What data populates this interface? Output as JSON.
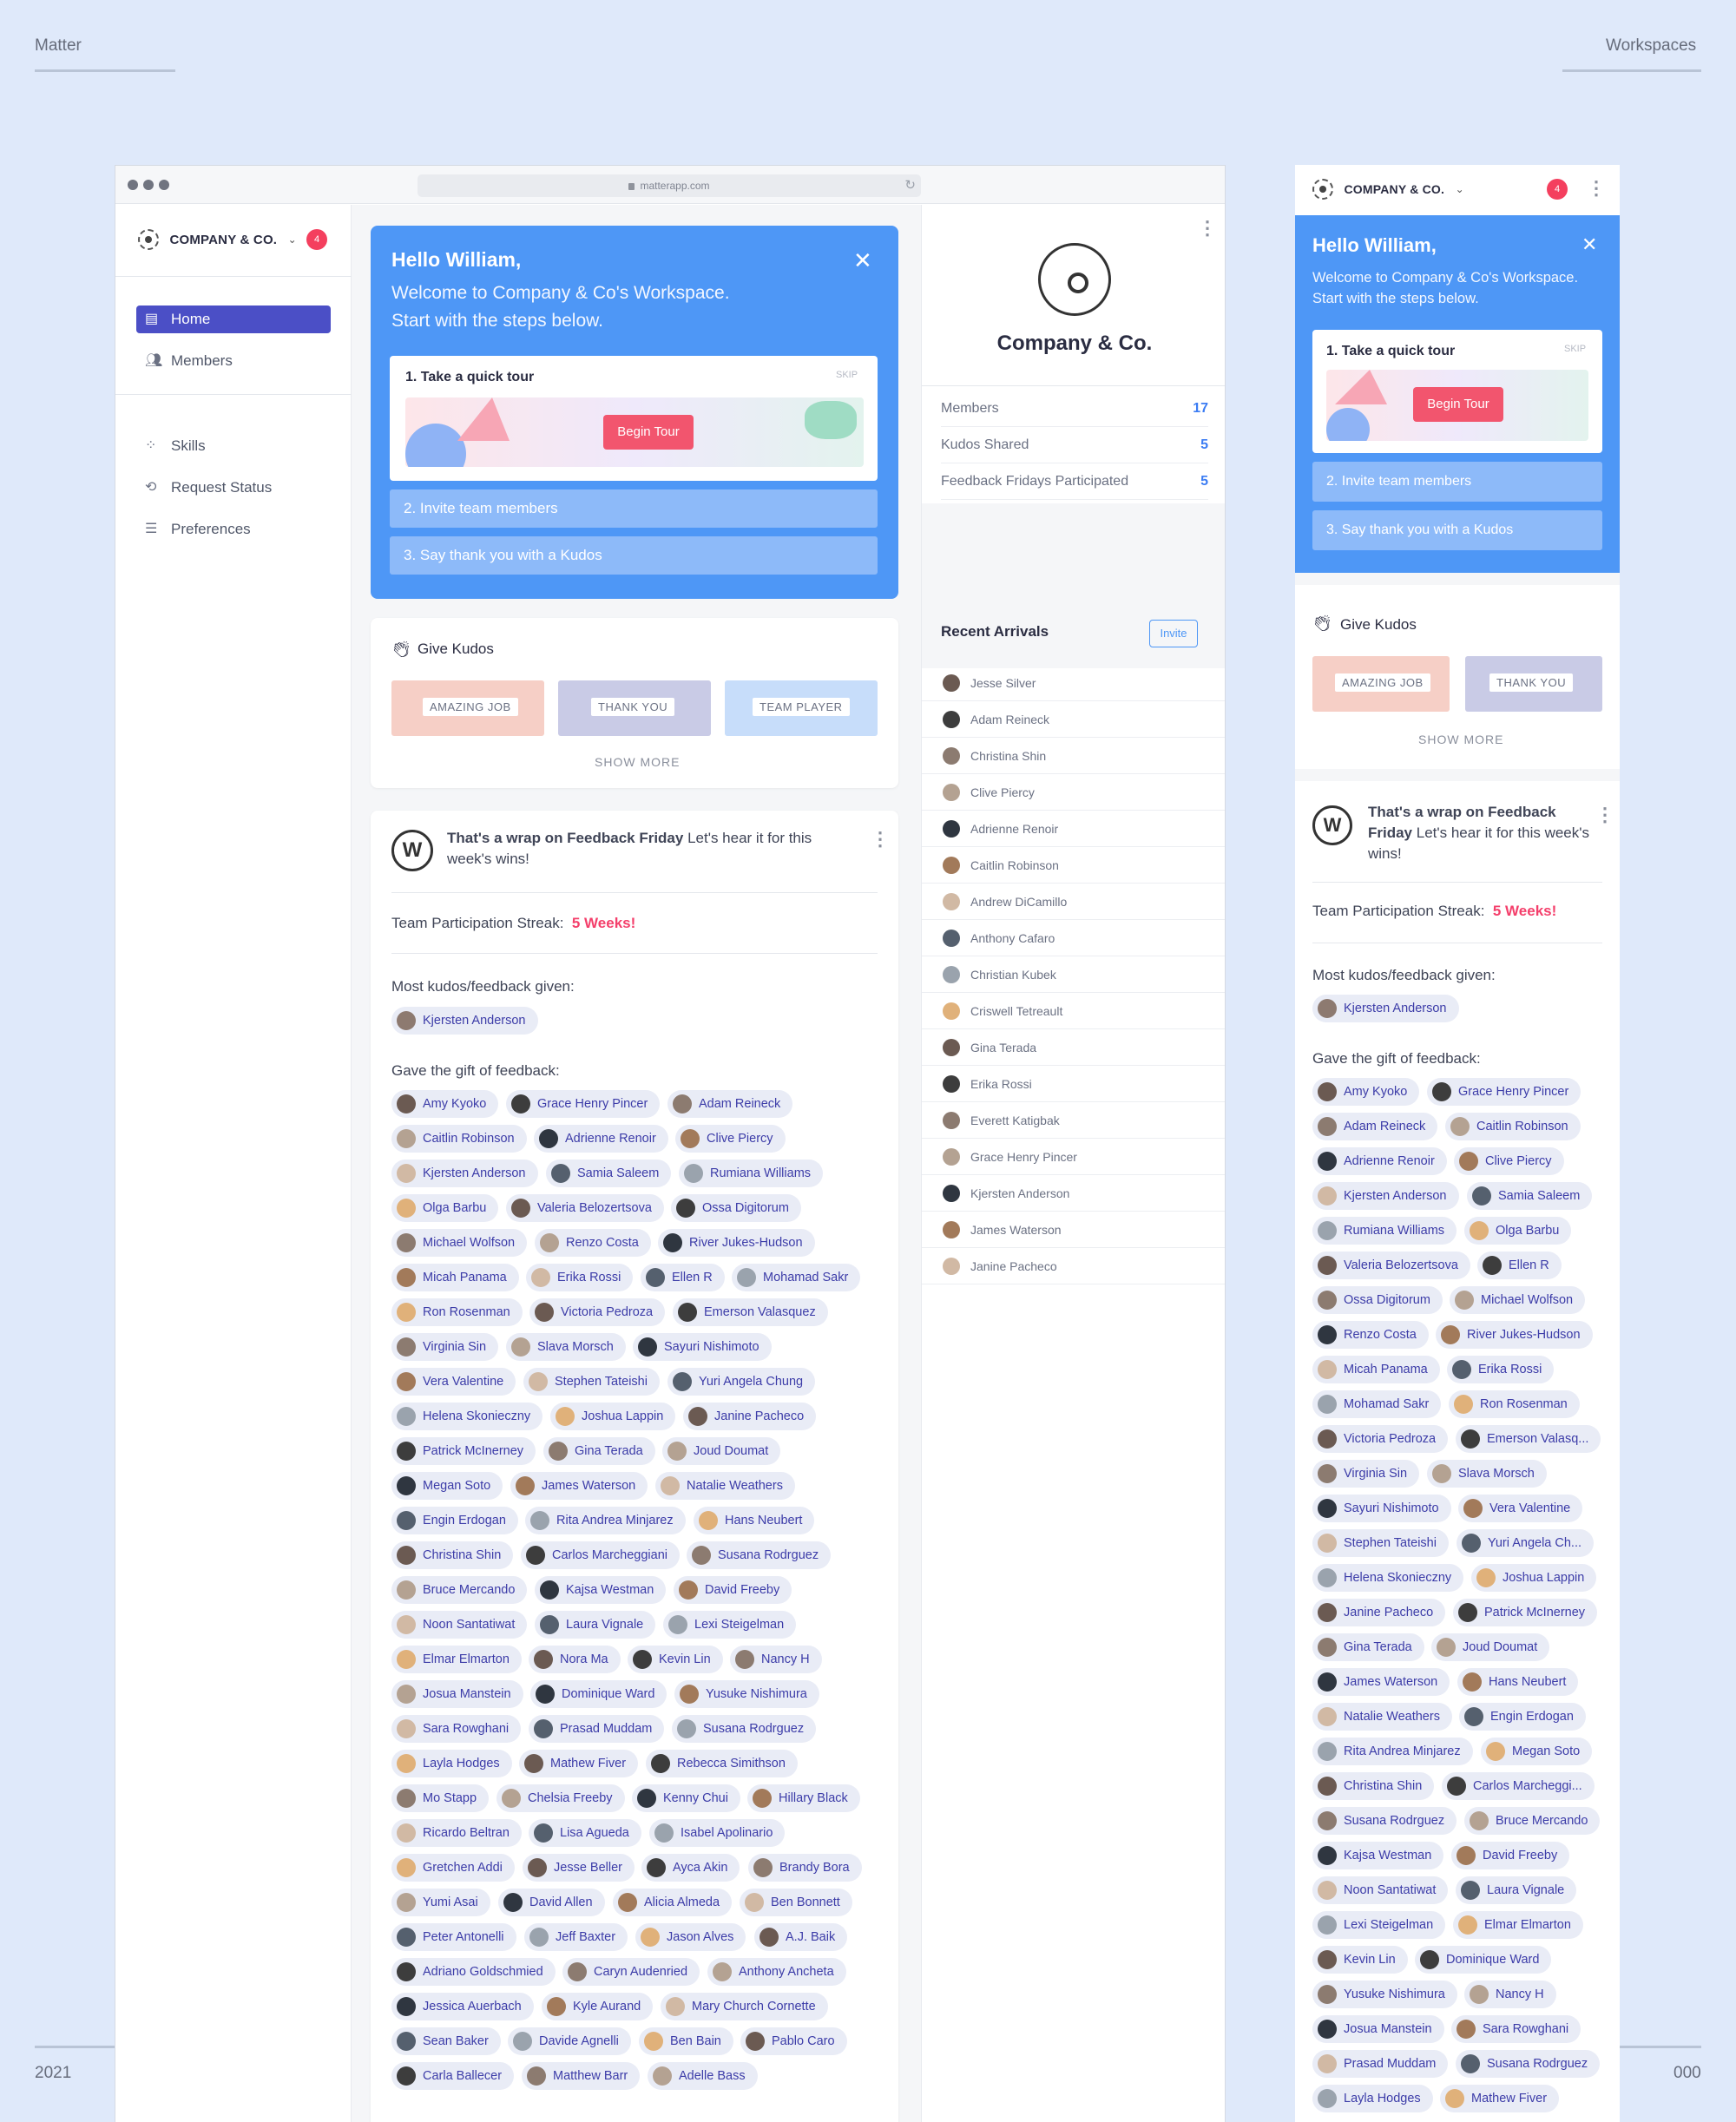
{
  "corners": {
    "tl": "Matter",
    "tr": "Workspaces",
    "bl": "2021",
    "br": "000"
  },
  "browser": {
    "url": "matterapp.com"
  },
  "org": {
    "name": "COMPANY & CO.",
    "notifications": "4",
    "display_name": "Company & Co."
  },
  "nav": {
    "items": [
      {
        "label": "Home",
        "icon": "chat-icon"
      },
      {
        "label": "Members",
        "icon": "people-icon"
      },
      {
        "label": "Skills",
        "icon": "grid-icon"
      },
      {
        "label": "Request Status",
        "icon": "refresh-icon"
      },
      {
        "label": "Preferences",
        "icon": "sliders-icon"
      }
    ]
  },
  "welcome": {
    "greeting": "Hello William,",
    "line1": "Welcome to Company & Co's Workspace.",
    "line2": "Start with the steps below.",
    "mobile_text": "Welcome to Company & Co's Workspace. Start with the steps below.",
    "step1": "1. Take a quick tour",
    "skip": "SKIP",
    "begin": "Begin Tour",
    "step2": "2. Invite team members",
    "step3": "3. Say thank you with a Kudos"
  },
  "kudos": {
    "title": "Give Kudos",
    "tiles": [
      "AMAZING JOB",
      "THANK YOU",
      "TEAM PLAYER"
    ],
    "show_more": "SHOW MORE"
  },
  "feedback": {
    "headline_bold": "That's a wrap on Feedback Friday",
    "headline_rest": " Let's hear it for this week's wins!",
    "streak_label": "Team Participation Streak:",
    "streak_value": "5 Weeks!",
    "most_label": "Most kudos/feedback given:",
    "most_name": "Kjersten Anderson",
    "gave_label": "Gave the gift of feedback:",
    "names": [
      "Amy Kyoko",
      "Grace Henry Pincer",
      "Adam Reineck",
      "Caitlin Robinson",
      "Adrienne Renoir",
      "Clive Piercy",
      "Kjersten Anderson",
      "Samia Saleem",
      "Rumiana Williams",
      "Olga Barbu",
      "Valeria Belozertsova",
      "Ossa Digitorum",
      "Michael Wolfson",
      "Renzo Costa",
      "River Jukes-Hudson",
      "Micah Panama",
      "Erika Rossi",
      "Ellen R",
      "Mohamad Sakr",
      "Ron Rosenman",
      "Victoria Pedroza",
      "Emerson Valasquez",
      "Virginia Sin",
      "Slava Morsch",
      "Sayuri Nishimoto",
      "Vera Valentine",
      "Stephen Tateishi",
      "Yuri Angela Chung",
      "Helena Skonieczny",
      "Joshua Lappin",
      "Janine Pacheco",
      "Patrick McInerney",
      "Gina Terada",
      "Joud Doumat",
      "Megan Soto",
      "James Waterson",
      "Natalie Weathers",
      "Engin Erdogan",
      "Rita Andrea Minjarez",
      "Hans Neubert",
      "Christina Shin",
      "Carlos Marcheggiani",
      "Susana Rodrguez",
      "Bruce Mercando",
      "Kajsa Westman",
      "David Freeby",
      "Noon Santatiwat",
      "Laura Vignale",
      "Lexi Steigelman",
      "Elmar Elmarton",
      "Nora Ma",
      "Kevin Lin",
      "Nancy H",
      "Josua Manstein",
      "Dominique Ward",
      "Yusuke Nishimura",
      "Sara Rowghani",
      "Prasad Muddam",
      "Susana Rodrguez",
      "Layla Hodges",
      "Mathew Fiver",
      "Rebecca Simithson",
      "Mo Stapp",
      "Chelsia Freeby",
      "Kenny Chui",
      "Hillary Black",
      "Ricardo Beltran",
      "Lisa Agueda",
      "Isabel Apolinario",
      "Gretchen Addi",
      "Jesse Beller",
      "Ayca Akin",
      "Brandy Bora",
      "Yumi Asai",
      "David Allen",
      "Alicia Almeda",
      "Ben Bonnett",
      "Peter Antonelli",
      "Jeff Baxter",
      "Jason Alves",
      "A.J. Baik",
      "Adriano Goldschmied",
      "Caryn Audenried",
      "Anthony Ancheta",
      "Jessica Auerbach",
      "Kyle Aurand",
      "Mary Church Cornette",
      "Sean Baker",
      "Davide Agnelli",
      "Ben Bain",
      "Pablo Caro",
      "Carla Ballecer",
      "Matthew Barr",
      "Adelle Bass"
    ],
    "mobile_names": [
      "Amy Kyoko",
      "Grace Henry Pincer",
      "Adam Reineck",
      "Caitlin Robinson",
      "Adrienne Renoir",
      "Clive Piercy",
      "Kjersten Anderson",
      "Samia Saleem",
      "Rumiana Williams",
      "Olga Barbu",
      "Valeria Belozertsova",
      "Ellen R",
      "Ossa Digitorum",
      "Michael Wolfson",
      "Renzo Costa",
      "River Jukes-Hudson",
      "Micah Panama",
      "Erika Rossi",
      "Mohamad Sakr",
      "Ron Rosenman",
      "Victoria Pedroza",
      "Emerson Valasq...",
      "Virginia Sin",
      "Slava Morsch",
      "Sayuri Nishimoto",
      "Vera Valentine",
      "Stephen Tateishi",
      "Yuri Angela Ch...",
      "Helena Skonieczny",
      "Joshua Lappin",
      "Janine Pacheco",
      "Patrick McInerney",
      "Gina Terada",
      "Joud Doumat",
      "James Waterson",
      "Hans Neubert",
      "Natalie Weathers",
      "Engin Erdogan",
      "Rita Andrea Minjarez",
      "Megan Soto",
      "Christina Shin",
      "Carlos Marcheggi...",
      "Susana Rodrguez",
      "Bruce Mercando",
      "Kajsa Westman",
      "David Freeby",
      "Noon Santatiwat",
      "Laura Vignale",
      "Lexi Steigelman",
      "Elmar Elmarton",
      "Kevin Lin",
      "Dominique Ward",
      "Yusuke Nishimura",
      "Nancy H",
      "Josua Manstein",
      "Sara Rowghani",
      "Prasad Muddam",
      "Susana Rodrguez",
      "Layla Hodges",
      "Mathew Fiver"
    ]
  },
  "stats": [
    {
      "label": "Members",
      "value": "17"
    },
    {
      "label": "Kudos Shared",
      "value": "5"
    },
    {
      "label": "Feedback Fridays Participated",
      "value": "5"
    }
  ],
  "arrivals": {
    "title": "Recent Arrivals",
    "invite": "Invite",
    "names": [
      "Jesse Silver",
      "Adam Reineck",
      "Christina Shin",
      "Clive Piercy",
      "Adrienne Renoir",
      "Caitlin Robinson",
      "Andrew DiCamillo",
      "Anthony Cafaro",
      "Christian Kubek",
      "Criswell Tetreault",
      "Gina Terada",
      "Erika Rossi",
      "Everett Katigbak",
      "Grace Henry Pincer",
      "Kjersten Anderson",
      "James Waterson",
      "Janine Pacheco"
    ]
  },
  "colors": {
    "accent": "#4b4fc6",
    "welcome_bg": "#4e97f6",
    "streak": "#f43f6b",
    "chip_bg": "#e9ecf6"
  }
}
